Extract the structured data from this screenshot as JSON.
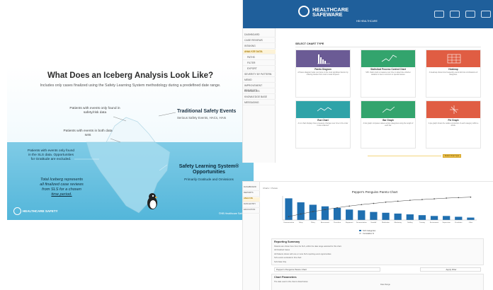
{
  "slide": {
    "title": "What Does an Iceberg Analysis Look Like?",
    "subtitle": "Includes only cases finalized using the Safety Learning System methodology during a predefined date range.",
    "label_safetyrisk": "Patients with events only found in safety/risk data",
    "label_both": "Patients with events in both data sets",
    "label_sls": "Patients with events only found in the SLS data. Opportunities for Gratitude are excluded.",
    "traditional_title": "Traditional Safety Events",
    "traditional_sub": "Serious Safety Events, HACs, HAIs",
    "sls_title": "Safety Learning System® Opportunities",
    "sls_sub": "Primarily Gratitude and Omissions",
    "total_line1": "Total Iceberg represents",
    "total_line2": "all finalized case reviews",
    "total_line3": "from SLS for a chosen",
    "total_line4": "time period.",
    "logo_text": "HEALTHCARE SAFETY",
    "footer": "©HB Healthcare Safety, INC"
  },
  "app1": {
    "brand_line1": "HEALTHCARE",
    "brand_line2": "SAFEWARE",
    "sub_logo": "HB HEALTHCARE",
    "nav": [
      {
        "label": "DASHBOARD",
        "active": false
      },
      {
        "label": "CASE REVIEWS",
        "active": false
      },
      {
        "label": "INTAKING",
        "active": false
      },
      {
        "label": "ANALYZE DATA",
        "active": true
      },
      {
        "label": "PATHS",
        "active": false
      },
      {
        "label": "FILTER",
        "active": false
      },
      {
        "label": "EXPORT",
        "active": false
      },
      {
        "label": "SEVERITY BY PATTERN",
        "active": false
      },
      {
        "label": "MEMO",
        "active": false
      },
      {
        "label": "IMPROVEMENT PROJECTS",
        "active": false
      },
      {
        "label": "RESOURCES",
        "active": false
      },
      {
        "label": "KNOWLEDGE BASE",
        "active": false
      },
      {
        "label": "MESSAGING",
        "active": false
      }
    ],
    "section_title": "SELECT CHART TYPE",
    "cards": [
      {
        "title": "Pareto Diagram",
        "desc": "A Pareto diagram helps you focus on the most significant factors by ordering causes from most to least frequent."
      },
      {
        "title": "Statistical Process Control Chart",
        "desc": "SPC charts track a measure over time to determine whether variation is due to common or special causes."
      },
      {
        "title": "Heatmap",
        "desc": "A heatmap shows how frequently events fall into combinations of categories."
      },
      {
        "title": "Run Chart",
        "desc": "A run chart displays how a measure changes over time in the order it was collected."
      },
      {
        "title": "Bar Graph",
        "desc": "A bar graph compares values across categories using the length of each bar."
      },
      {
        "title": "Pie Graph",
        "desc": "A pie graph shows the relative proportion of each category within a whole."
      }
    ],
    "select_button": "Select Chart Type"
  },
  "app2": {
    "nav": [
      {
        "label": "DASHBOARD",
        "active": false
      },
      {
        "label": "REPORTS",
        "active": false
      },
      {
        "label": "ANALYZE",
        "active": true
      },
      {
        "label": "DATA ENTRY",
        "active": false
      },
      {
        "label": "EDUCATION",
        "active": false
      }
    ],
    "crumb": "Charts > Pareto",
    "chart_title": "Pepper's Penguins Pareto Chart",
    "legend_bar": "SLS Categories",
    "legend_line": "Cumulative %",
    "reporting_title": "Reporting Summary",
    "reporting_text": "Patients are shown here from the SLS, within the date range selected for this chart.",
    "reporting_lines": [
      "All Finalized Cases",
      "All Patients shown with one or more SLS reporting event opportunities",
      "SLS events excluded in this chart",
      "SLS Data Only"
    ],
    "chart_name_field": "Pepper's Penguins Pareto Chart",
    "apply_button": "Apply Filter",
    "params_title": "Chart Parameters",
    "params_text": "The data used in this chart is listed below.",
    "date_range_label": "Date Range"
  },
  "chart_data": {
    "type": "bar",
    "title": "Pepper's Penguins Pareto Chart",
    "categories": [
      "Communication",
      "Delay",
      "Policy",
      "Assessment",
      "Procedure",
      "Equipment",
      "Documentation",
      "Handoff",
      "Medication",
      "Monitoring",
      "Staffing",
      "Training",
      "Environment",
      "Supervision",
      "Escalation",
      "Other"
    ],
    "series": [
      {
        "name": "SLS Categories",
        "values": [
          27,
          22,
          19,
          17,
          15,
          13,
          12,
          10,
          9,
          8,
          7,
          6,
          5,
          5,
          4,
          3
        ]
      },
      {
        "name": "Cumulative %",
        "values": [
          14,
          25,
          35,
          43,
          51,
          58,
          64,
          69,
          74,
          78,
          82,
          85,
          88,
          91,
          93,
          95
        ]
      }
    ],
    "ylim": [
      0,
      30
    ],
    "y2lim": [
      0,
      100
    ],
    "legend": "bottom",
    "grid": false
  },
  "colors": {
    "header": "#1f5f9b",
    "bar": "#1f6fb0",
    "line": "#444444",
    "card_purple": "#6b5b95",
    "card_green": "#33a46d",
    "card_red": "#e05d43",
    "card_teal": "#2fa3a8",
    "select_yellow": "#f0c24a"
  }
}
